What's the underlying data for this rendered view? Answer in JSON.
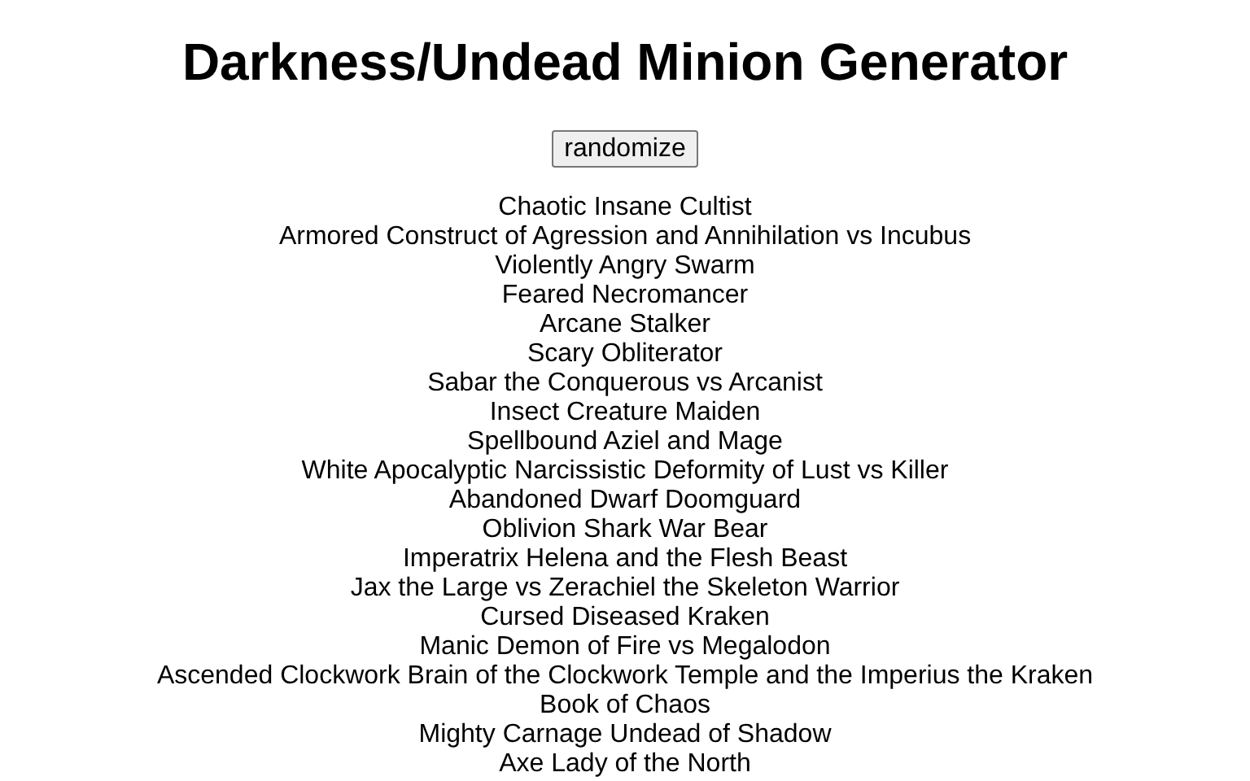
{
  "title": "Darkness/Undead Minion Generator",
  "button": "randomize",
  "minions": [
    "Chaotic Insane Cultist",
    "Armored Construct of Agression and Annihilation vs Incubus",
    "Violently Angry Swarm",
    "Feared Necromancer",
    "Arcane Stalker",
    "Scary Obliterator",
    "Sabar the Conquerous vs Arcanist",
    "Insect Creature Maiden",
    "Spellbound Aziel and Mage",
    "White Apocalyptic Narcissistic Deformity of Lust vs Killer",
    "Abandoned Dwarf Doomguard",
    "Oblivion Shark War Bear",
    "Imperatrix Helena and the Flesh Beast",
    "Jax the Large vs Zerachiel the Skeleton Warrior",
    "Cursed Diseased Kraken",
    "Manic Demon of Fire vs Megalodon",
    "Ascended Clockwork Brain of the Clockwork Temple and the Imperius the Kraken",
    "Book of Chaos",
    "Mighty Carnage Undead of Shadow",
    "Axe Lady of the North"
  ]
}
